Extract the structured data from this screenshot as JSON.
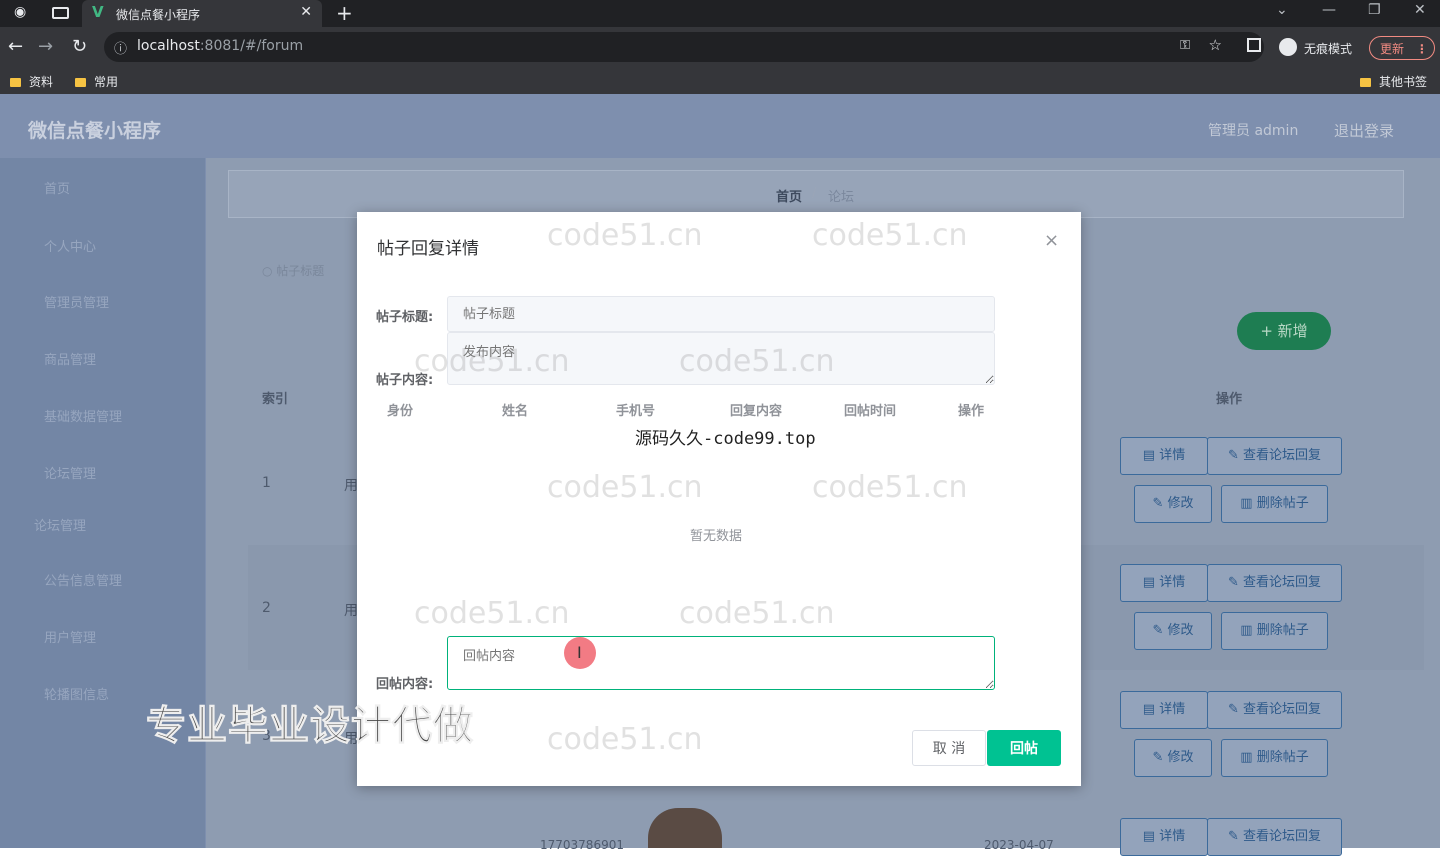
{
  "browser": {
    "tab_title": "微信点餐小程序",
    "tab_icon": "V",
    "new_tab": "+",
    "url_host": "localhost",
    "url_rest": ":8081/#/forum",
    "incognito_label": "无痕模式",
    "update_label": "更新",
    "bookmarks": [
      "资料",
      "常用"
    ],
    "other_bookmarks": "其他书签"
  },
  "app": {
    "title": "微信点餐小程序",
    "user_info": "管理员 admin",
    "logout": "退出登录",
    "sidebar": [
      "首页",
      "个人中心",
      "管理员管理",
      "商品管理",
      "基础数据管理",
      "论坛管理",
      "论坛管理",
      "公告信息管理",
      "用户管理",
      "轮播图信息"
    ],
    "breadcrumb": {
      "home": "首页",
      "sep": "/",
      "current": "论坛"
    },
    "search_label": "帖子标题",
    "add_button": "新增",
    "add_icon": "+",
    "table": {
      "index_header": "索引",
      "op_header": "操作",
      "rows": [
        {
          "index": "1",
          "snippet": "用"
        },
        {
          "index": "2",
          "snippet": "用"
        },
        {
          "index": "3",
          "snippet": "用"
        }
      ],
      "partial_row": {
        "phone": "17703786901",
        "date": "2023-04-07"
      }
    },
    "row_actions": {
      "detail": "详情",
      "view_replies": "查看论坛回复",
      "edit": "修改",
      "delete": "删除帖子"
    }
  },
  "dialog": {
    "title": "帖子回复详情",
    "close": "×",
    "post_title_label": "帖子标题:",
    "post_title_placeholder": "帖子标题",
    "post_content_label": "帖子内容:",
    "post_content_placeholder": "发布内容",
    "table_headers": [
      "身份",
      "姓名",
      "手机号",
      "回复内容",
      "回帖时间",
      "操作"
    ],
    "empty_text": "暂无数据",
    "reply_label": "回帖内容:",
    "reply_placeholder": "回帖内容",
    "cancel": "取 消",
    "submit": "回帖"
  },
  "overlays": {
    "source_watermark": "源码久久-code99.top",
    "promo_watermark": "专业毕业设计代做",
    "faint_watermark": "code51.cn"
  },
  "colors": {
    "accent": "#00c292",
    "input_focus": "#00b27a",
    "add_button": "#1e7d52"
  }
}
